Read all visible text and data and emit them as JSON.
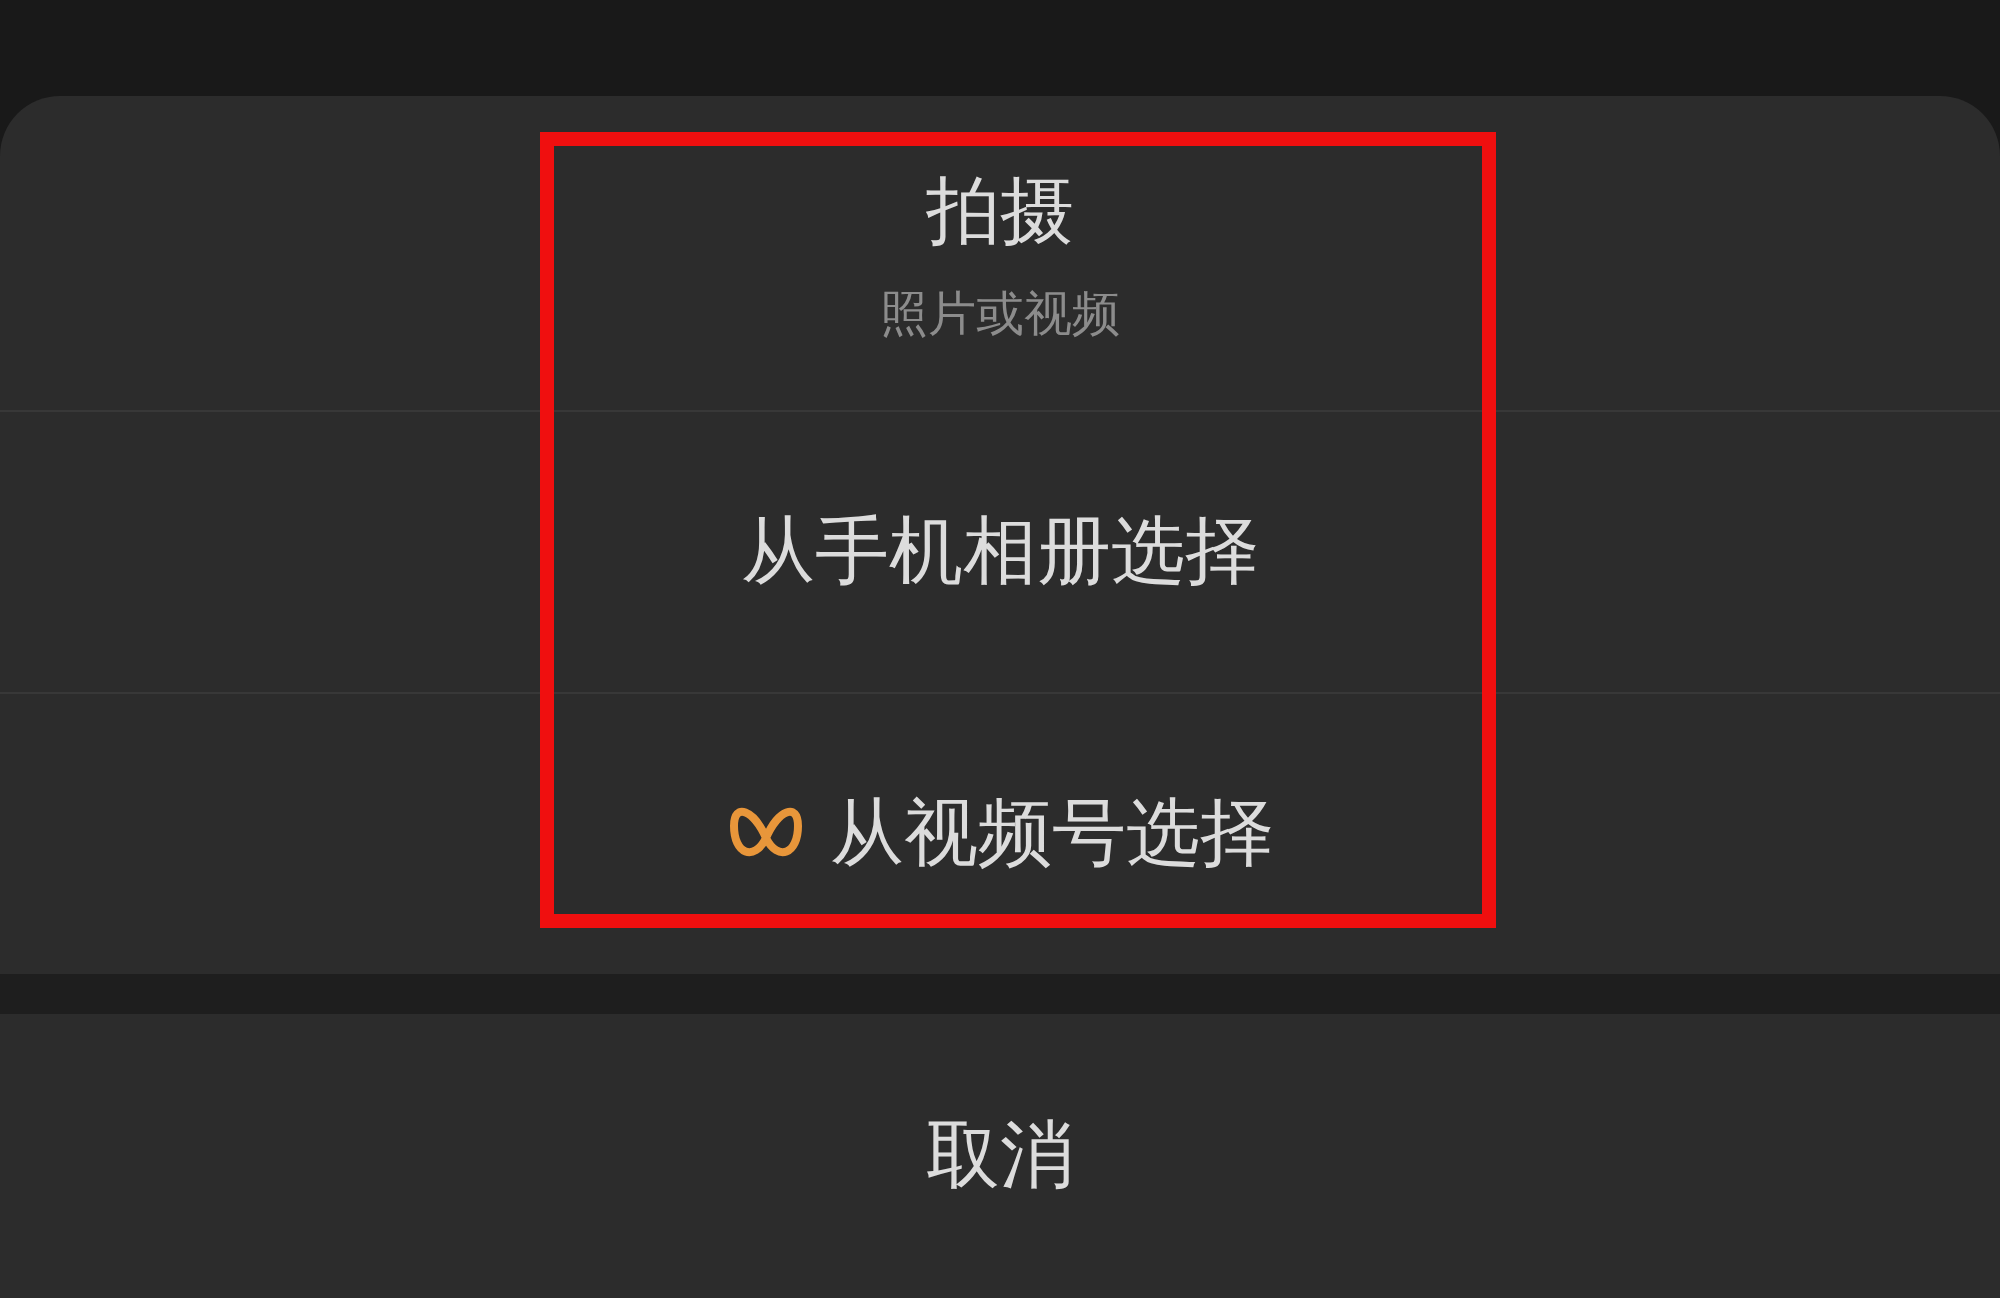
{
  "options": [
    {
      "kind": "text",
      "title": "拍摄",
      "subtitle": "照片或视频",
      "highlighted": true
    },
    {
      "kind": "text",
      "title": "从手机相册选择",
      "highlighted": true
    },
    {
      "kind": "icon-text",
      "title": "从视频号选择",
      "highlighted": true
    }
  ],
  "cancel": {
    "label": "取消"
  }
}
